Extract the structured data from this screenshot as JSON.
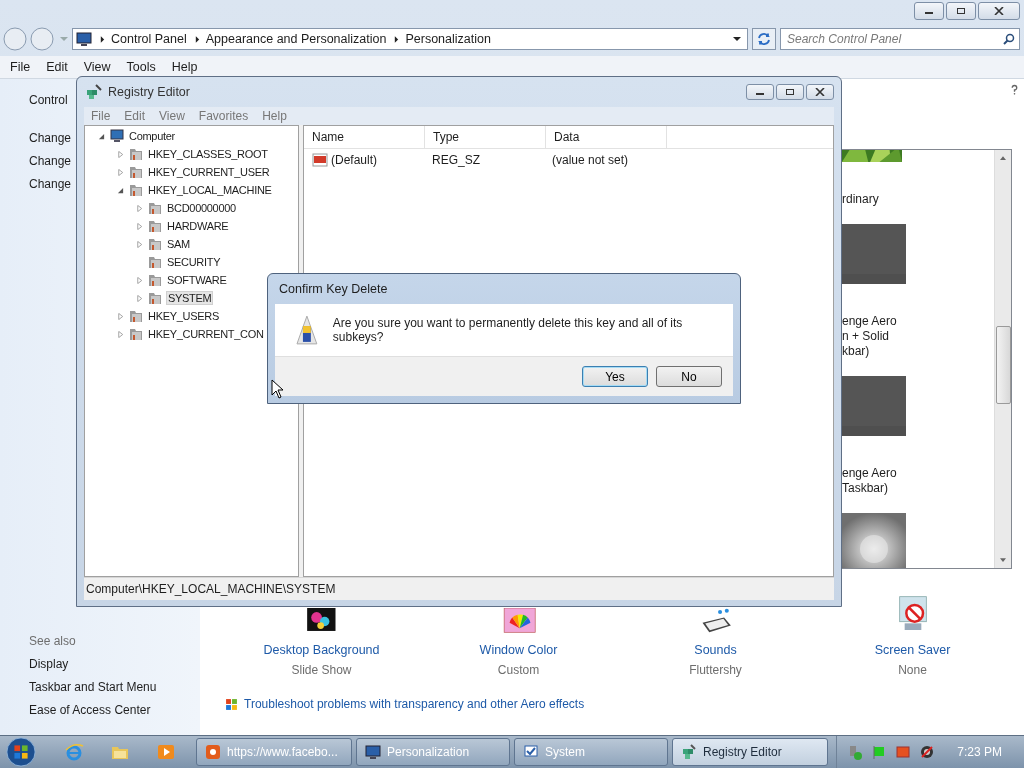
{
  "explorer": {
    "address": {
      "crumbs": [
        "Control Panel",
        "Appearance and Personalization",
        "Personalization"
      ]
    },
    "search": {
      "placeholder": "Search Control Panel"
    },
    "menu": [
      "File",
      "Edit",
      "View",
      "Tools",
      "Help"
    ],
    "sidebar": {
      "top_links": [
        "Control",
        "Change",
        "Change",
        "Change"
      ],
      "see_also": {
        "heading": "See also",
        "links": [
          "Display",
          "Taskbar and Start Menu",
          "Ease of Access Center"
        ]
      }
    },
    "themes": [
      {
        "kind": "picture",
        "label": [
          "rdinary"
        ]
      },
      {
        "kind": "picture",
        "label": [
          "enge Aero",
          "n + Solid",
          "kbar)"
        ]
      },
      {
        "kind": "picture",
        "label": [
          "enge Aero",
          "Taskbar)"
        ]
      },
      {
        "kind": "picture"
      }
    ],
    "settings": [
      {
        "kind": "desktop-background",
        "title": "Desktop Background",
        "value": "Slide Show"
      },
      {
        "kind": "window-color",
        "title": "Window Color",
        "value": "Custom"
      },
      {
        "kind": "sounds",
        "title": "Sounds",
        "value": "Fluttershy"
      },
      {
        "kind": "screen-saver",
        "title": "Screen Saver",
        "value": "None"
      }
    ],
    "troubleshoot_link": "Troubleshoot problems with transparency and other Aero effects"
  },
  "registry_editor": {
    "title": "Registry Editor",
    "menu": [
      "File",
      "Edit",
      "View",
      "Favorites",
      "Help"
    ],
    "tree": [
      {
        "label": "Computer",
        "has_children": true,
        "expanded": true,
        "selected": false,
        "children": [
          {
            "label": "HKEY_CLASSES_ROOT",
            "has_children": true,
            "expanded": false,
            "selected": false
          },
          {
            "label": "HKEY_CURRENT_USER",
            "has_children": true,
            "expanded": false,
            "selected": false
          },
          {
            "label": "HKEY_LOCAL_MACHINE",
            "has_children": true,
            "expanded": true,
            "selected": false,
            "children": [
              {
                "label": "BCD00000000",
                "has_children": true,
                "expanded": false,
                "selected": false
              },
              {
                "label": "HARDWARE",
                "has_children": true,
                "expanded": false,
                "selected": false
              },
              {
                "label": "SAM",
                "has_children": true,
                "expanded": false,
                "selected": false
              },
              {
                "label": "SECURITY",
                "has_children": false,
                "selected": false
              },
              {
                "label": "SOFTWARE",
                "has_children": true,
                "expanded": false,
                "selected": false
              },
              {
                "label": "SYSTEM",
                "has_children": true,
                "expanded": false,
                "selected": true
              }
            ]
          },
          {
            "label": "HKEY_USERS",
            "has_children": true,
            "expanded": false,
            "selected": false
          },
          {
            "label": "HKEY_CURRENT_CON",
            "has_children": true,
            "expanded": false,
            "selected": false
          }
        ]
      }
    ],
    "columns": [
      "Name",
      "Type",
      "Data"
    ],
    "values": [
      {
        "name": "(Default)",
        "type": "REG_SZ",
        "data": "(value not set)"
      }
    ],
    "status": "Computer\\HKEY_LOCAL_MACHINE\\SYSTEM"
  },
  "dialog": {
    "title": "Confirm Key Delete",
    "message": "Are you sure you want to permanently delete this key and all of its subkeys?",
    "buttons": [
      {
        "label": "Yes",
        "default": true
      },
      {
        "label": "No",
        "default": false
      }
    ]
  },
  "taskbar": {
    "tasks": [
      {
        "label": "https://www.facebo...",
        "selected": false
      },
      {
        "label": "Personalization",
        "selected": false
      },
      {
        "label": "System",
        "selected": false
      },
      {
        "label": "Registry Editor",
        "selected": true
      }
    ],
    "clock": "7:23 PM"
  }
}
